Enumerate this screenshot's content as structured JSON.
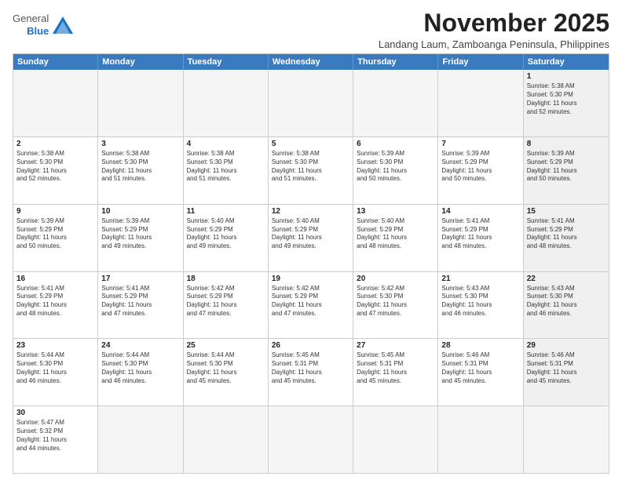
{
  "header": {
    "logo_line1": "General",
    "logo_line2": "Blue",
    "month": "November 2025",
    "location": "Landang Laum, Zamboanga Peninsula, Philippines"
  },
  "day_headers": [
    "Sunday",
    "Monday",
    "Tuesday",
    "Wednesday",
    "Thursday",
    "Friday",
    "Saturday"
  ],
  "weeks": [
    {
      "cells": [
        {
          "day": "",
          "info": "",
          "empty": true
        },
        {
          "day": "",
          "info": "",
          "empty": true
        },
        {
          "day": "",
          "info": "",
          "empty": true
        },
        {
          "day": "",
          "info": "",
          "empty": true
        },
        {
          "day": "",
          "info": "",
          "empty": true
        },
        {
          "day": "",
          "info": "",
          "empty": true
        },
        {
          "day": "1",
          "info": "Sunrise: 5:38 AM\nSunset: 5:30 PM\nDaylight: 11 hours\nand 52 minutes.",
          "shade": true
        }
      ]
    },
    {
      "cells": [
        {
          "day": "2",
          "info": "Sunrise: 5:38 AM\nSunset: 5:30 PM\nDaylight: 11 hours\nand 52 minutes."
        },
        {
          "day": "3",
          "info": "Sunrise: 5:38 AM\nSunset: 5:30 PM\nDaylight: 11 hours\nand 51 minutes."
        },
        {
          "day": "4",
          "info": "Sunrise: 5:38 AM\nSunset: 5:30 PM\nDaylight: 11 hours\nand 51 minutes."
        },
        {
          "day": "5",
          "info": "Sunrise: 5:38 AM\nSunset: 5:30 PM\nDaylight: 11 hours\nand 51 minutes."
        },
        {
          "day": "6",
          "info": "Sunrise: 5:39 AM\nSunset: 5:30 PM\nDaylight: 11 hours\nand 50 minutes."
        },
        {
          "day": "7",
          "info": "Sunrise: 5:39 AM\nSunset: 5:29 PM\nDaylight: 11 hours\nand 50 minutes."
        },
        {
          "day": "8",
          "info": "Sunrise: 5:39 AM\nSunset: 5:29 PM\nDaylight: 11 hours\nand 50 minutes.",
          "shade": true
        }
      ]
    },
    {
      "cells": [
        {
          "day": "9",
          "info": "Sunrise: 5:39 AM\nSunset: 5:29 PM\nDaylight: 11 hours\nand 50 minutes."
        },
        {
          "day": "10",
          "info": "Sunrise: 5:39 AM\nSunset: 5:29 PM\nDaylight: 11 hours\nand 49 minutes."
        },
        {
          "day": "11",
          "info": "Sunrise: 5:40 AM\nSunset: 5:29 PM\nDaylight: 11 hours\nand 49 minutes."
        },
        {
          "day": "12",
          "info": "Sunrise: 5:40 AM\nSunset: 5:29 PM\nDaylight: 11 hours\nand 49 minutes."
        },
        {
          "day": "13",
          "info": "Sunrise: 5:40 AM\nSunset: 5:29 PM\nDaylight: 11 hours\nand 48 minutes."
        },
        {
          "day": "14",
          "info": "Sunrise: 5:41 AM\nSunset: 5:29 PM\nDaylight: 11 hours\nand 48 minutes."
        },
        {
          "day": "15",
          "info": "Sunrise: 5:41 AM\nSunset: 5:29 PM\nDaylight: 11 hours\nand 48 minutes.",
          "shade": true
        }
      ]
    },
    {
      "cells": [
        {
          "day": "16",
          "info": "Sunrise: 5:41 AM\nSunset: 5:29 PM\nDaylight: 11 hours\nand 48 minutes."
        },
        {
          "day": "17",
          "info": "Sunrise: 5:41 AM\nSunset: 5:29 PM\nDaylight: 11 hours\nand 47 minutes."
        },
        {
          "day": "18",
          "info": "Sunrise: 5:42 AM\nSunset: 5:29 PM\nDaylight: 11 hours\nand 47 minutes."
        },
        {
          "day": "19",
          "info": "Sunrise: 5:42 AM\nSunset: 5:29 PM\nDaylight: 11 hours\nand 47 minutes."
        },
        {
          "day": "20",
          "info": "Sunrise: 5:42 AM\nSunset: 5:30 PM\nDaylight: 11 hours\nand 47 minutes."
        },
        {
          "day": "21",
          "info": "Sunrise: 5:43 AM\nSunset: 5:30 PM\nDaylight: 11 hours\nand 46 minutes."
        },
        {
          "day": "22",
          "info": "Sunrise: 5:43 AM\nSunset: 5:30 PM\nDaylight: 11 hours\nand 46 minutes.",
          "shade": true
        }
      ]
    },
    {
      "cells": [
        {
          "day": "23",
          "info": "Sunrise: 5:44 AM\nSunset: 5:30 PM\nDaylight: 11 hours\nand 46 minutes."
        },
        {
          "day": "24",
          "info": "Sunrise: 5:44 AM\nSunset: 5:30 PM\nDaylight: 11 hours\nand 46 minutes."
        },
        {
          "day": "25",
          "info": "Sunrise: 5:44 AM\nSunset: 5:30 PM\nDaylight: 11 hours\nand 45 minutes."
        },
        {
          "day": "26",
          "info": "Sunrise: 5:45 AM\nSunset: 5:31 PM\nDaylight: 11 hours\nand 45 minutes."
        },
        {
          "day": "27",
          "info": "Sunrise: 5:45 AM\nSunset: 5:31 PM\nDaylight: 11 hours\nand 45 minutes."
        },
        {
          "day": "28",
          "info": "Sunrise: 5:46 AM\nSunset: 5:31 PM\nDaylight: 11 hours\nand 45 minutes."
        },
        {
          "day": "29",
          "info": "Sunrise: 5:46 AM\nSunset: 5:31 PM\nDaylight: 11 hours\nand 45 minutes.",
          "shade": true
        }
      ]
    },
    {
      "cells": [
        {
          "day": "30",
          "info": "Sunrise: 5:47 AM\nSunset: 5:32 PM\nDaylight: 11 hours\nand 44 minutes."
        },
        {
          "day": "",
          "info": "",
          "empty": true
        },
        {
          "day": "",
          "info": "",
          "empty": true
        },
        {
          "day": "",
          "info": "",
          "empty": true
        },
        {
          "day": "",
          "info": "",
          "empty": true
        },
        {
          "day": "",
          "info": "",
          "empty": true
        },
        {
          "day": "",
          "info": "",
          "empty": true,
          "shade": true
        }
      ]
    }
  ]
}
